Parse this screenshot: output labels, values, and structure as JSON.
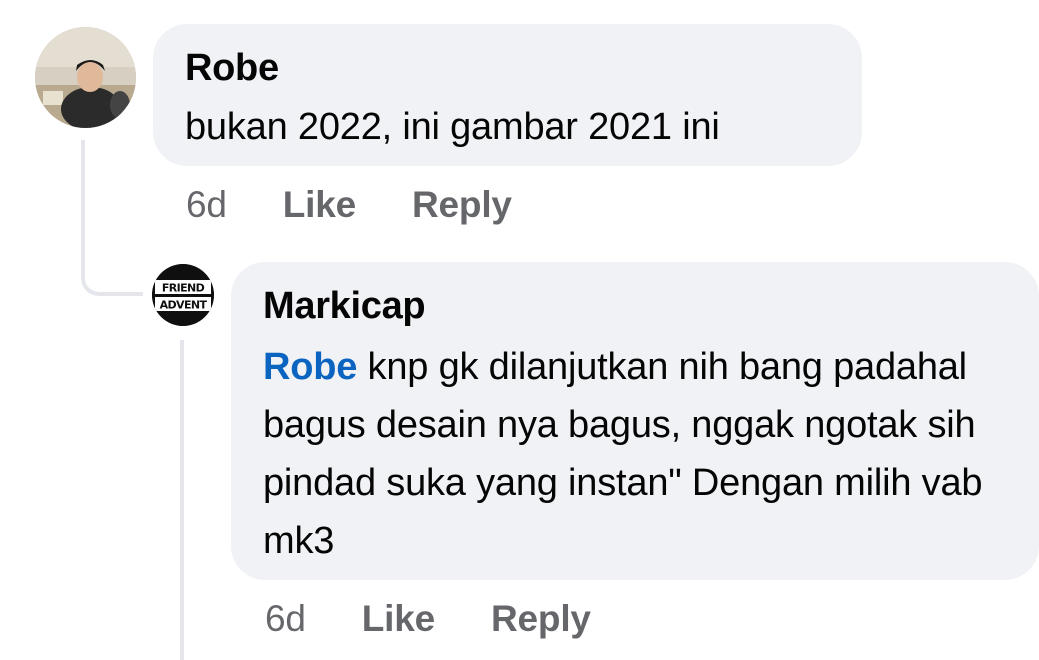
{
  "comments": [
    {
      "author": "Robe",
      "text": "bukan 2022, ini gambar 2021 ini",
      "time": "6d",
      "like_label": "Like",
      "reply_label": "Reply"
    },
    {
      "author": "Markicap",
      "mention": "Robe",
      "text": " knp gk dilanjutkan nih bang padahal bagus desain nya bagus, nggak ngotak sih pindad suka yang instan\" Dengan milih vab mk3",
      "time": "6d",
      "like_label": "Like",
      "reply_label": "Reply",
      "avatar_text": [
        "FRIEND",
        "ADVENT"
      ]
    }
  ]
}
